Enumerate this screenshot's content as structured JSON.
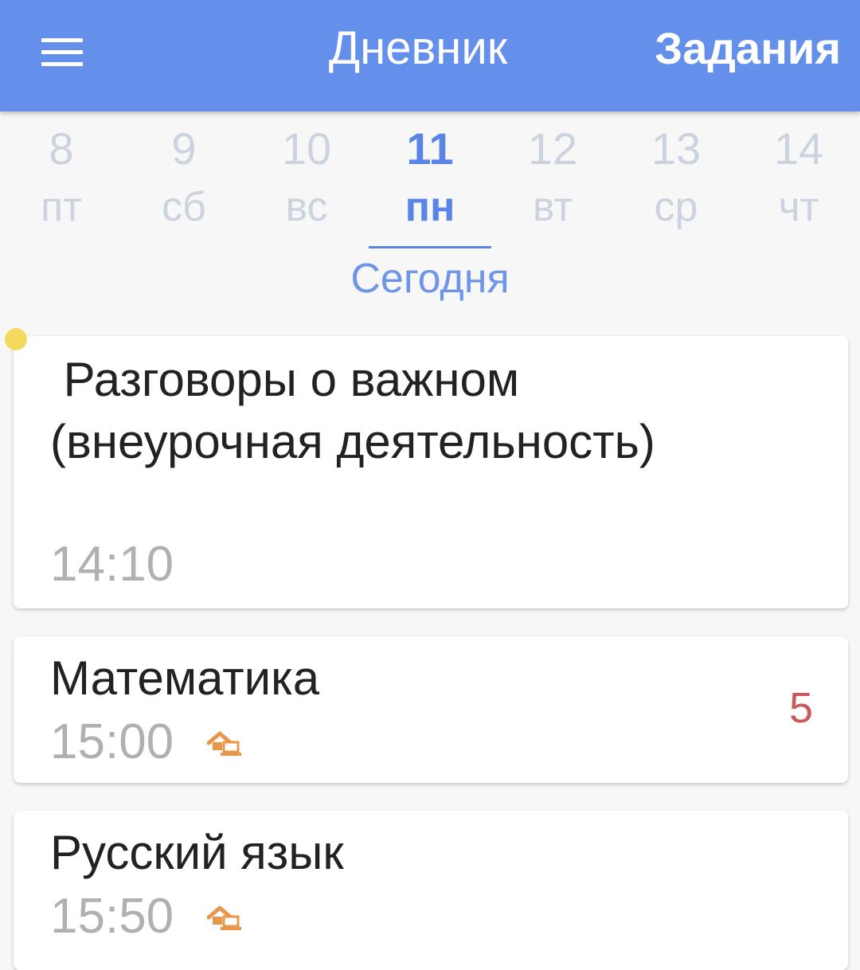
{
  "header": {
    "title": "Дневник",
    "tasks_label": "Задания"
  },
  "date_strip": {
    "days": [
      {
        "num": "8",
        "weekday": "пт"
      },
      {
        "num": "9",
        "weekday": "сб"
      },
      {
        "num": "10",
        "weekday": "вс"
      },
      {
        "num": "11",
        "weekday": "пн"
      },
      {
        "num": "12",
        "weekday": "вт"
      },
      {
        "num": "13",
        "weekday": "ср"
      },
      {
        "num": "14",
        "weekday": "чт"
      }
    ],
    "selected_index": 3,
    "today_label": "Сегодня"
  },
  "lessons": [
    {
      "title": " Разговоры о важном (внеурочная деятельность)",
      "time": "14:10",
      "grade": "",
      "icon": ""
    },
    {
      "title": "Математика",
      "time": "15:00",
      "grade": "5",
      "icon": "home-computer-icon"
    },
    {
      "title": "Русский язык",
      "time": "15:50",
      "grade": "",
      "icon": "home-computer-icon"
    }
  ],
  "colors": {
    "header_bg": "#6490ec",
    "accent": "#5a85e6",
    "grade": "#c9595c",
    "marker_dot": "#f3da5e",
    "icon": "#e8974a"
  }
}
